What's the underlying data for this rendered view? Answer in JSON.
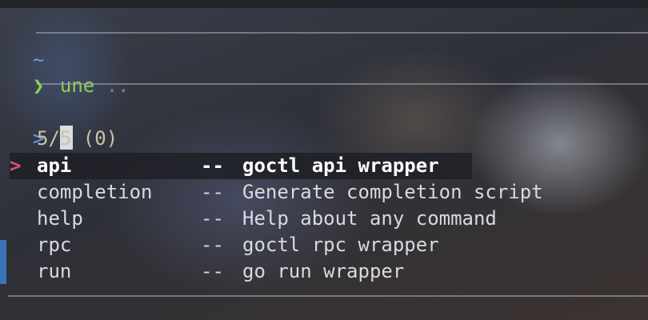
{
  "prompt_prev": {
    "path": "~",
    "arrow": "❯",
    "command": "une",
    "suggestion": " .."
  },
  "finder": {
    "prompt": ">",
    "query": "",
    "count": "5/5 (0)",
    "pointer": ">"
  },
  "items": [
    {
      "name": "api",
      "sep": "--",
      "desc": "goctl api wrapper"
    },
    {
      "name": "completion",
      "sep": "--",
      "desc": "Generate completion script"
    },
    {
      "name": "help",
      "sep": "--",
      "desc": "Help about any command"
    },
    {
      "name": "rpc",
      "sep": "--",
      "desc": "goctl rpc wrapper"
    },
    {
      "name": "run",
      "sep": "--",
      "desc": "go run wrapper"
    }
  ],
  "selected_index": 0,
  "colors": {
    "path": "#6b9ee0",
    "command": "#8ad04f",
    "pointer": "#e0507a",
    "prompt": "#6b9ee0"
  }
}
